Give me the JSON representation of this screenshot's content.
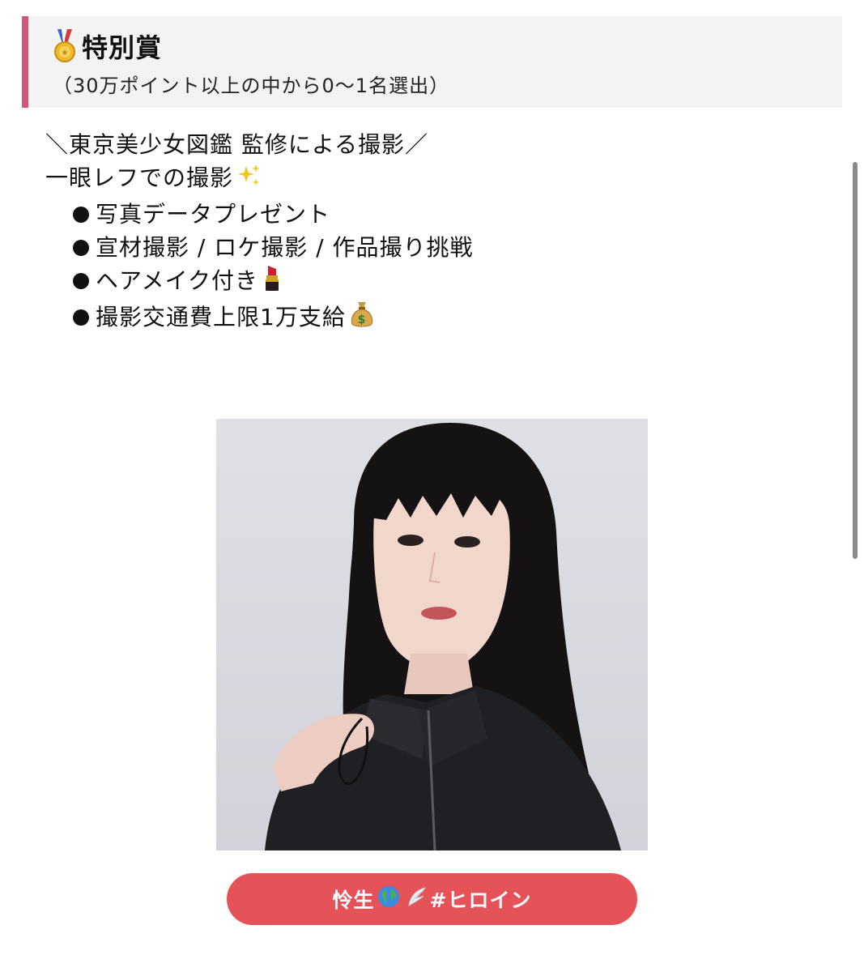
{
  "award": {
    "icon": "medal-icon",
    "title": "特別賞",
    "subtitle": "（30万ポイント以上の中から0〜1名選出）",
    "accent_color": "#d2557a"
  },
  "description": {
    "line1": "＼東京美少女図鑑 監修による撮影／",
    "line2": "一眼レフでの撮影",
    "line2_icon": "sparkles-icon",
    "bullets": [
      {
        "text": "写真データプレゼント",
        "icon": ""
      },
      {
        "text": "宣材撮影 / ロケ撮影 / 作品撮り挑戦",
        "icon": ""
      },
      {
        "text": "ヘアメイク付き",
        "icon": "lipstick-icon"
      },
      {
        "text": "撮影交通費上限1万支給",
        "icon": "money-bag-icon"
      }
    ]
  },
  "photo": {
    "subject": "portrait-photo"
  },
  "name_button": {
    "name": "怜生",
    "icon1": "globe-icon",
    "icon2": "wing-icon",
    "tag": "#ヒロイン",
    "color": "#e55257"
  }
}
